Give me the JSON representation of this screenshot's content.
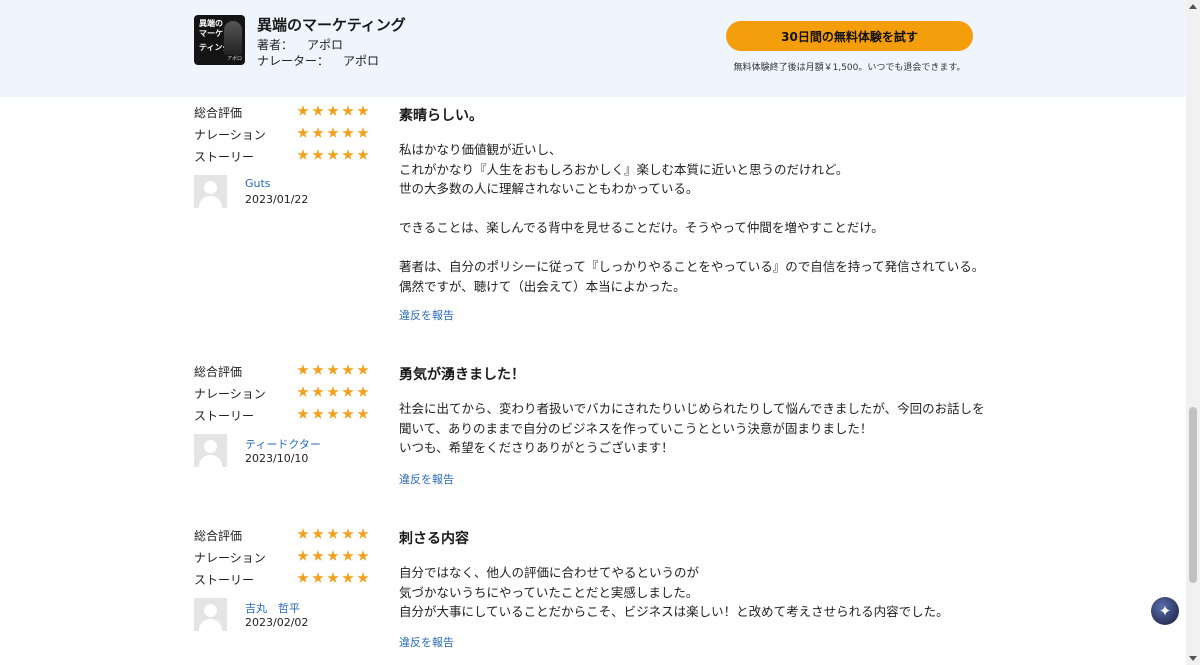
{
  "header": {
    "cover": {
      "line1": "異端の",
      "line2": "マーケ",
      "line3": "ティング",
      "author": "アポロ"
    },
    "title": "異端のマーケティング",
    "author_label": "著者：",
    "author_value": "アポロ",
    "narrator_label": "ナレーター：",
    "narrator_value": "アポロ",
    "trial_button": "30日間の無料体験を試す",
    "trial_note": "無料体験終了後は月額￥1,500。いつでも退会できます。",
    "accent_color": "#f59e0b",
    "background_color": "#eef5fd"
  },
  "rating_labels": {
    "overall": "総合評価",
    "narration": "ナレーション",
    "story": "ストーリー"
  },
  "reviews": [
    {
      "ratings": {
        "overall": 5,
        "narration": 5,
        "story": 5
      },
      "user": "Guts",
      "date": "2023/01/22",
      "title": "素晴らしい。",
      "body": [
        "私はかなり価値観が近いし、",
        "これがかなり『人生をおもしろおかしく』楽しむ本質に近いと思うのだけれど。",
        "世の大多数の人に理解されないこともわかっている。",
        "できることは、楽しんでる背中を見せることだけ。そうやって仲間を増やすことだけ。",
        "著者は、自分のポリシーに従って『しっかりやることをやっている』ので自信を持って発信されている。偶然ですが、聴けて（出会えて）本当によかった。"
      ],
      "report": "違反を報告"
    },
    {
      "ratings": {
        "overall": 5,
        "narration": 5,
        "story": 5
      },
      "user": "ティードクター",
      "date": "2023/10/10",
      "title": "勇気が湧きました！",
      "body": [
        "社会に出てから、変わり者扱いでバカにされたりいじめられたりして悩んできましたが、今回のお話しを聞いて、ありのままで自分のビジネスを作っていこうとという決意が固まりました！",
        "いつも、希望をくださりありがとうございます！"
      ],
      "report": "違反を報告"
    },
    {
      "ratings": {
        "overall": 5,
        "narration": 5,
        "story": 5
      },
      "user": "吉丸　哲平",
      "date": "2023/02/02",
      "title": "刺さる内容",
      "body": [
        "自分ではなく、他人の評価に合わせてやるというのが",
        "気づかないうちにやっていたことだと実感しました。",
        "自分が大事にしていることだからこそ、ビジネスは楽しい！と改めて考えさせられる内容でした。"
      ],
      "report": "違反を報告"
    }
  ],
  "star_color": "#f2a11f",
  "assistant_icon": "sparkle-icon"
}
